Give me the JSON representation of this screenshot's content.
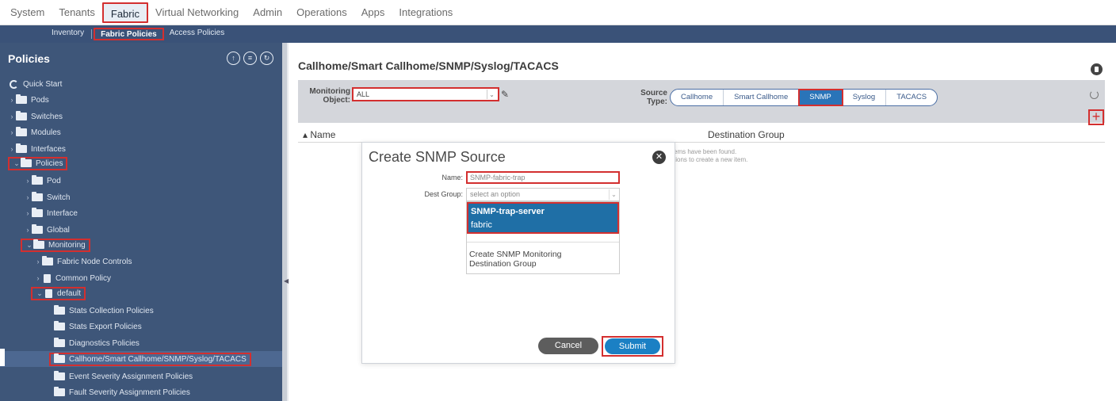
{
  "topnav": {
    "tabs": [
      "System",
      "Tenants",
      "Fabric",
      "Virtual Networking",
      "Admin",
      "Operations",
      "Apps",
      "Integrations"
    ],
    "active": "Fabric"
  },
  "subnav": {
    "items": [
      "Inventory",
      "Fabric Policies",
      "Access Policies"
    ],
    "active": "Fabric Policies"
  },
  "sidebar": {
    "title": "Policies",
    "quick_start": "Quick Start",
    "items": {
      "pods": "Pods",
      "switches": "Switches",
      "modules": "Modules",
      "interfaces": "Interfaces",
      "policies": "Policies",
      "pod": "Pod",
      "switch": "Switch",
      "interface": "Interface",
      "global": "Global",
      "monitoring": "Monitoring",
      "fabric_node_controls": "Fabric Node Controls",
      "common_policy": "Common Policy",
      "default": "default",
      "stats_collection": "Stats Collection Policies",
      "stats_export": "Stats Export Policies",
      "diagnostics": "Diagnostics Policies",
      "callhome": "Callhome/Smart Callhome/SNMP/Syslog/TACACS",
      "event_severity": "Event Severity Assignment Policies",
      "fault_severity": "Fault Severity Assignment Policies"
    }
  },
  "main": {
    "title": "Callhome/Smart Callhome/SNMP/Syslog/TACACS",
    "monitoring_object_label": "Monitoring Object:",
    "monitoring_object_value": "ALL",
    "source_type_label": "Source Type:",
    "source_types": [
      "Callhome",
      "Smart Callhome",
      "SNMP",
      "Syslog",
      "TACACS"
    ],
    "source_type_active": "SNMP",
    "columns": [
      "Name",
      "Destination Group"
    ],
    "empty_line1": "ems have been found.",
    "empty_line2": "tions to create a new item."
  },
  "modal": {
    "title": "Create SNMP Source",
    "name_label": "Name:",
    "name_value": "SNMP-fabric-trap",
    "dest_group_label": "Dest Group:",
    "dest_group_placeholder": "select an option",
    "options": [
      "SNMP-trap-server",
      "fabric"
    ],
    "create_option": "Create SNMP Monitoring Destination Group",
    "cancel_label": "Cancel",
    "submit_label": "Submit"
  },
  "colors": {
    "sidebar_bg": "#3e5679",
    "subnav_bg": "#3a5278",
    "highlight_red": "#d32f2f",
    "accent_blue": "#2a74b8"
  }
}
